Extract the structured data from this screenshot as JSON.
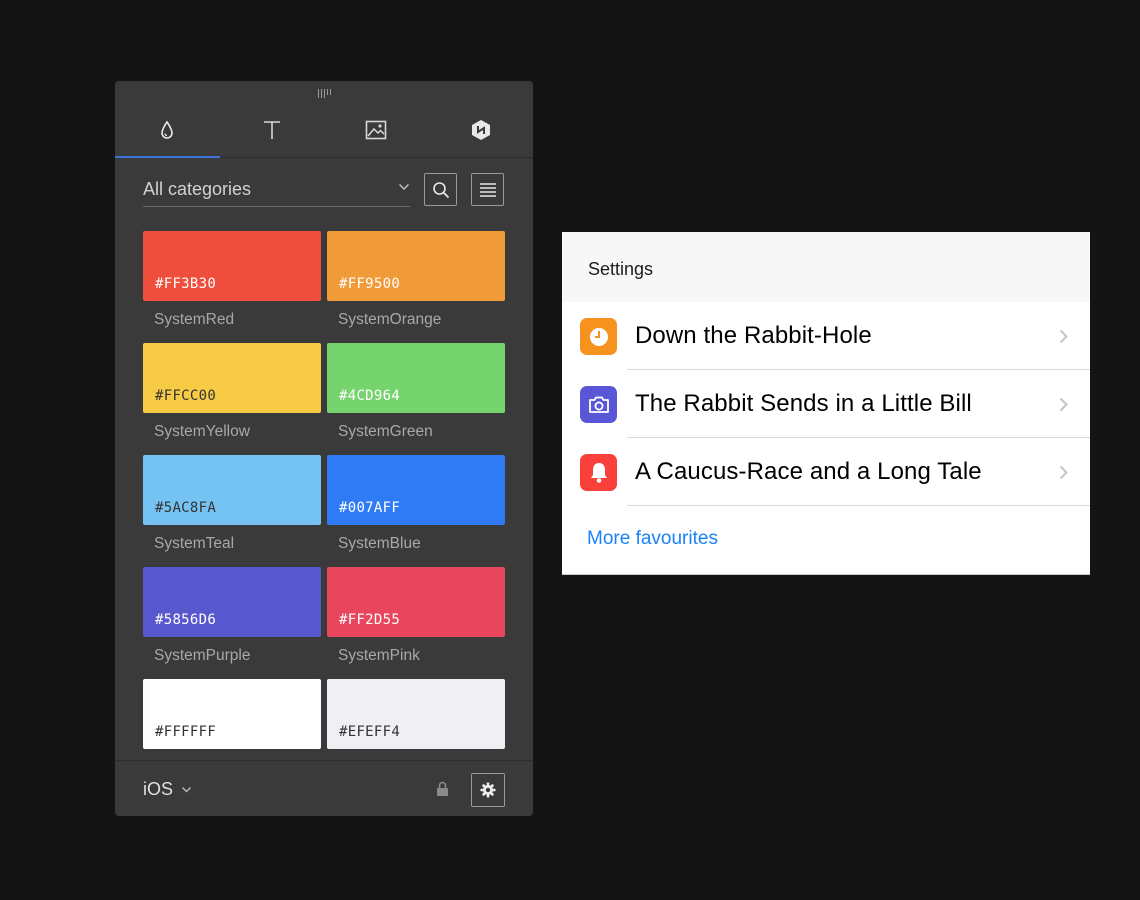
{
  "palette_panel": {
    "tabs": [
      {
        "name": "colors",
        "icon": "droplet-icon",
        "active": true
      },
      {
        "name": "text",
        "icon": "text-icon",
        "active": false
      },
      {
        "name": "images",
        "icon": "image-icon",
        "active": false
      },
      {
        "name": "plugin",
        "icon": "hexagon-logo-icon",
        "active": false
      }
    ],
    "category_select": {
      "value": "All categories",
      "icon": "chevron-down-icon"
    },
    "search_button": {
      "icon": "search-icon"
    },
    "list_button": {
      "icon": "list-view-icon"
    },
    "swatches": [
      {
        "hex": "#FF3B30",
        "name": "SystemRed",
        "color": "#EF4E3C",
        "text_color": "#ffffff"
      },
      {
        "hex": "#FF9500",
        "name": "SystemOrange",
        "color": "#F09A38",
        "text_color": "#ffffff"
      },
      {
        "hex": "#FFCC00",
        "name": "SystemYellow",
        "color": "#F7CB45",
        "text_color": "#333333"
      },
      {
        "hex": "#4CD964",
        "name": "SystemGreen",
        "color": "#76D46F",
        "text_color": "#ffffff"
      },
      {
        "hex": "#5AC8FA",
        "name": "SystemTeal",
        "color": "#74C3F2",
        "text_color": "#333333"
      },
      {
        "hex": "#007AFF",
        "name": "SystemBlue",
        "color": "#2F7BF5",
        "text_color": "#ffffff"
      },
      {
        "hex": "#5856D6",
        "name": "SystemPurple",
        "color": "#5858CE",
        "text_color": "#ffffff"
      },
      {
        "hex": "#FF2D55",
        "name": "SystemPink",
        "color": "#E8465C",
        "text_color": "#ffffff"
      },
      {
        "hex": "#FFFFFF",
        "name": "",
        "color": "#FFFFFF",
        "text_color": "#333333"
      },
      {
        "hex": "#EFEFF4",
        "name": "",
        "color": "#EFEFF4",
        "text_color": "#333333"
      }
    ],
    "footer": {
      "platform": "iOS",
      "platform_icon": "chevron-down-icon",
      "lock_icon": "lock-icon",
      "settings_icon": "gear-icon"
    }
  },
  "settings_card": {
    "header": "Settings",
    "rows": [
      {
        "label": "Down the Rabbit-Hole",
        "icon": "clock-icon",
        "icon_color": "#F7921E"
      },
      {
        "label": "The Rabbit Sends in a Little Bill",
        "icon": "camera-icon",
        "icon_color": "#5A57D6"
      },
      {
        "label": "A Caucus-Race and a Long Tale",
        "icon": "bell-icon",
        "icon_color": "#F9403A"
      }
    ],
    "more_link": "More favourites",
    "accent_color": "#1A82FB"
  }
}
